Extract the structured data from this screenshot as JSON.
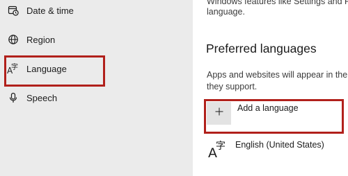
{
  "sidebar": {
    "items": [
      {
        "label": "Date & time",
        "icon": "clock-calendar-icon"
      },
      {
        "label": "Region",
        "icon": "globe-icon"
      },
      {
        "label": "Language",
        "icon": "language-icon"
      },
      {
        "label": "Speech",
        "icon": "microphone-icon"
      }
    ]
  },
  "main": {
    "intro_line1": "Windows features like Settings and Fi",
    "intro_line2": "language.",
    "section_title": "Preferred languages",
    "section_desc_line1": "Apps and websites will appear in the f",
    "section_desc_line2": "they support.",
    "add_language": {
      "icon": "plus-icon",
      "label": "Add a language"
    },
    "languages": [
      {
        "name": "English (United States)",
        "icon": "language-icon"
      }
    ]
  },
  "colors": {
    "highlight": "#b1201b",
    "sidebar_bg": "#ebebeb",
    "button_bg": "#e3e3e3"
  }
}
